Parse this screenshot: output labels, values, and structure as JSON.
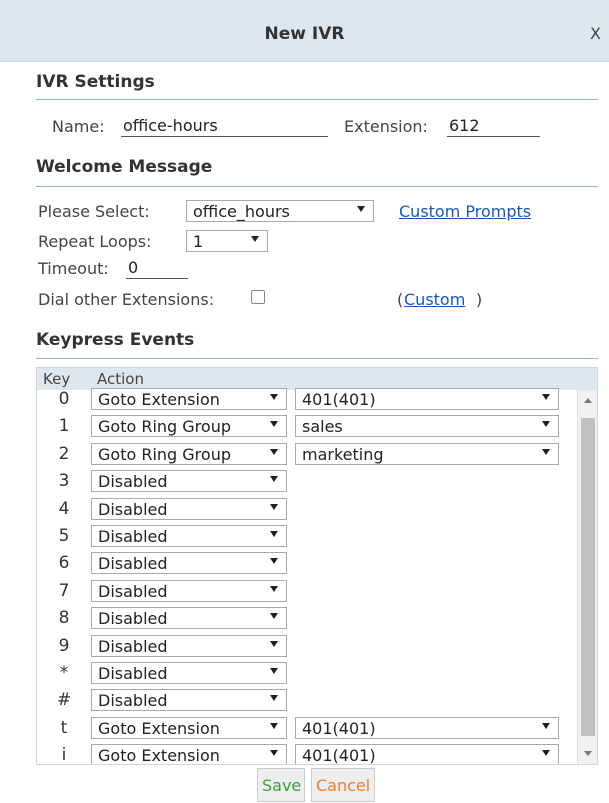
{
  "dialog": {
    "title": "New IVR",
    "close_label": "X"
  },
  "ivr_settings": {
    "section_title": "IVR Settings",
    "name_label": "Name:",
    "name_value": "office-hours",
    "extension_label": "Extension:",
    "extension_value": "612"
  },
  "welcome": {
    "section_title": "Welcome Message",
    "please_select_label": "Please Select:",
    "please_select_value": "office_hours",
    "custom_prompts_link": "Custom Prompts",
    "repeat_loops_label": "Repeat Loops:",
    "repeat_loops_value": "1",
    "timeout_label": "Timeout:",
    "timeout_value": "0",
    "dial_other_label": "Dial other Extensions:",
    "dial_other_checked": false,
    "custom_open": "(",
    "custom_link": "Custom",
    "custom_close": ")"
  },
  "keypress": {
    "section_title": "Keypress Events",
    "headers": {
      "key": "Key",
      "action": "Action"
    },
    "rows": [
      {
        "key": "0",
        "action": "Goto Extension",
        "target": "401(401)"
      },
      {
        "key": "1",
        "action": "Goto Ring Group",
        "target": "sales"
      },
      {
        "key": "2",
        "action": "Goto Ring Group",
        "target": "marketing"
      },
      {
        "key": "3",
        "action": "Disabled",
        "target": ""
      },
      {
        "key": "4",
        "action": "Disabled",
        "target": ""
      },
      {
        "key": "5",
        "action": "Disabled",
        "target": ""
      },
      {
        "key": "6",
        "action": "Disabled",
        "target": ""
      },
      {
        "key": "7",
        "action": "Disabled",
        "target": ""
      },
      {
        "key": "8",
        "action": "Disabled",
        "target": ""
      },
      {
        "key": "9",
        "action": "Disabled",
        "target": ""
      },
      {
        "key": "*",
        "action": "Disabled",
        "target": ""
      },
      {
        "key": "#",
        "action": "Disabled",
        "target": ""
      },
      {
        "key": "t",
        "action": "Goto Extension",
        "target": "401(401)"
      },
      {
        "key": "i",
        "action": "Goto Extension",
        "target": "401(401)"
      }
    ]
  },
  "buttons": {
    "save_label": "Save",
    "cancel_label": "Cancel"
  },
  "colors": {
    "save_text": "#3aa13a",
    "cancel_text": "#f07c2b",
    "link": "#1a56b8",
    "header_bg": "#dfe7ee"
  }
}
